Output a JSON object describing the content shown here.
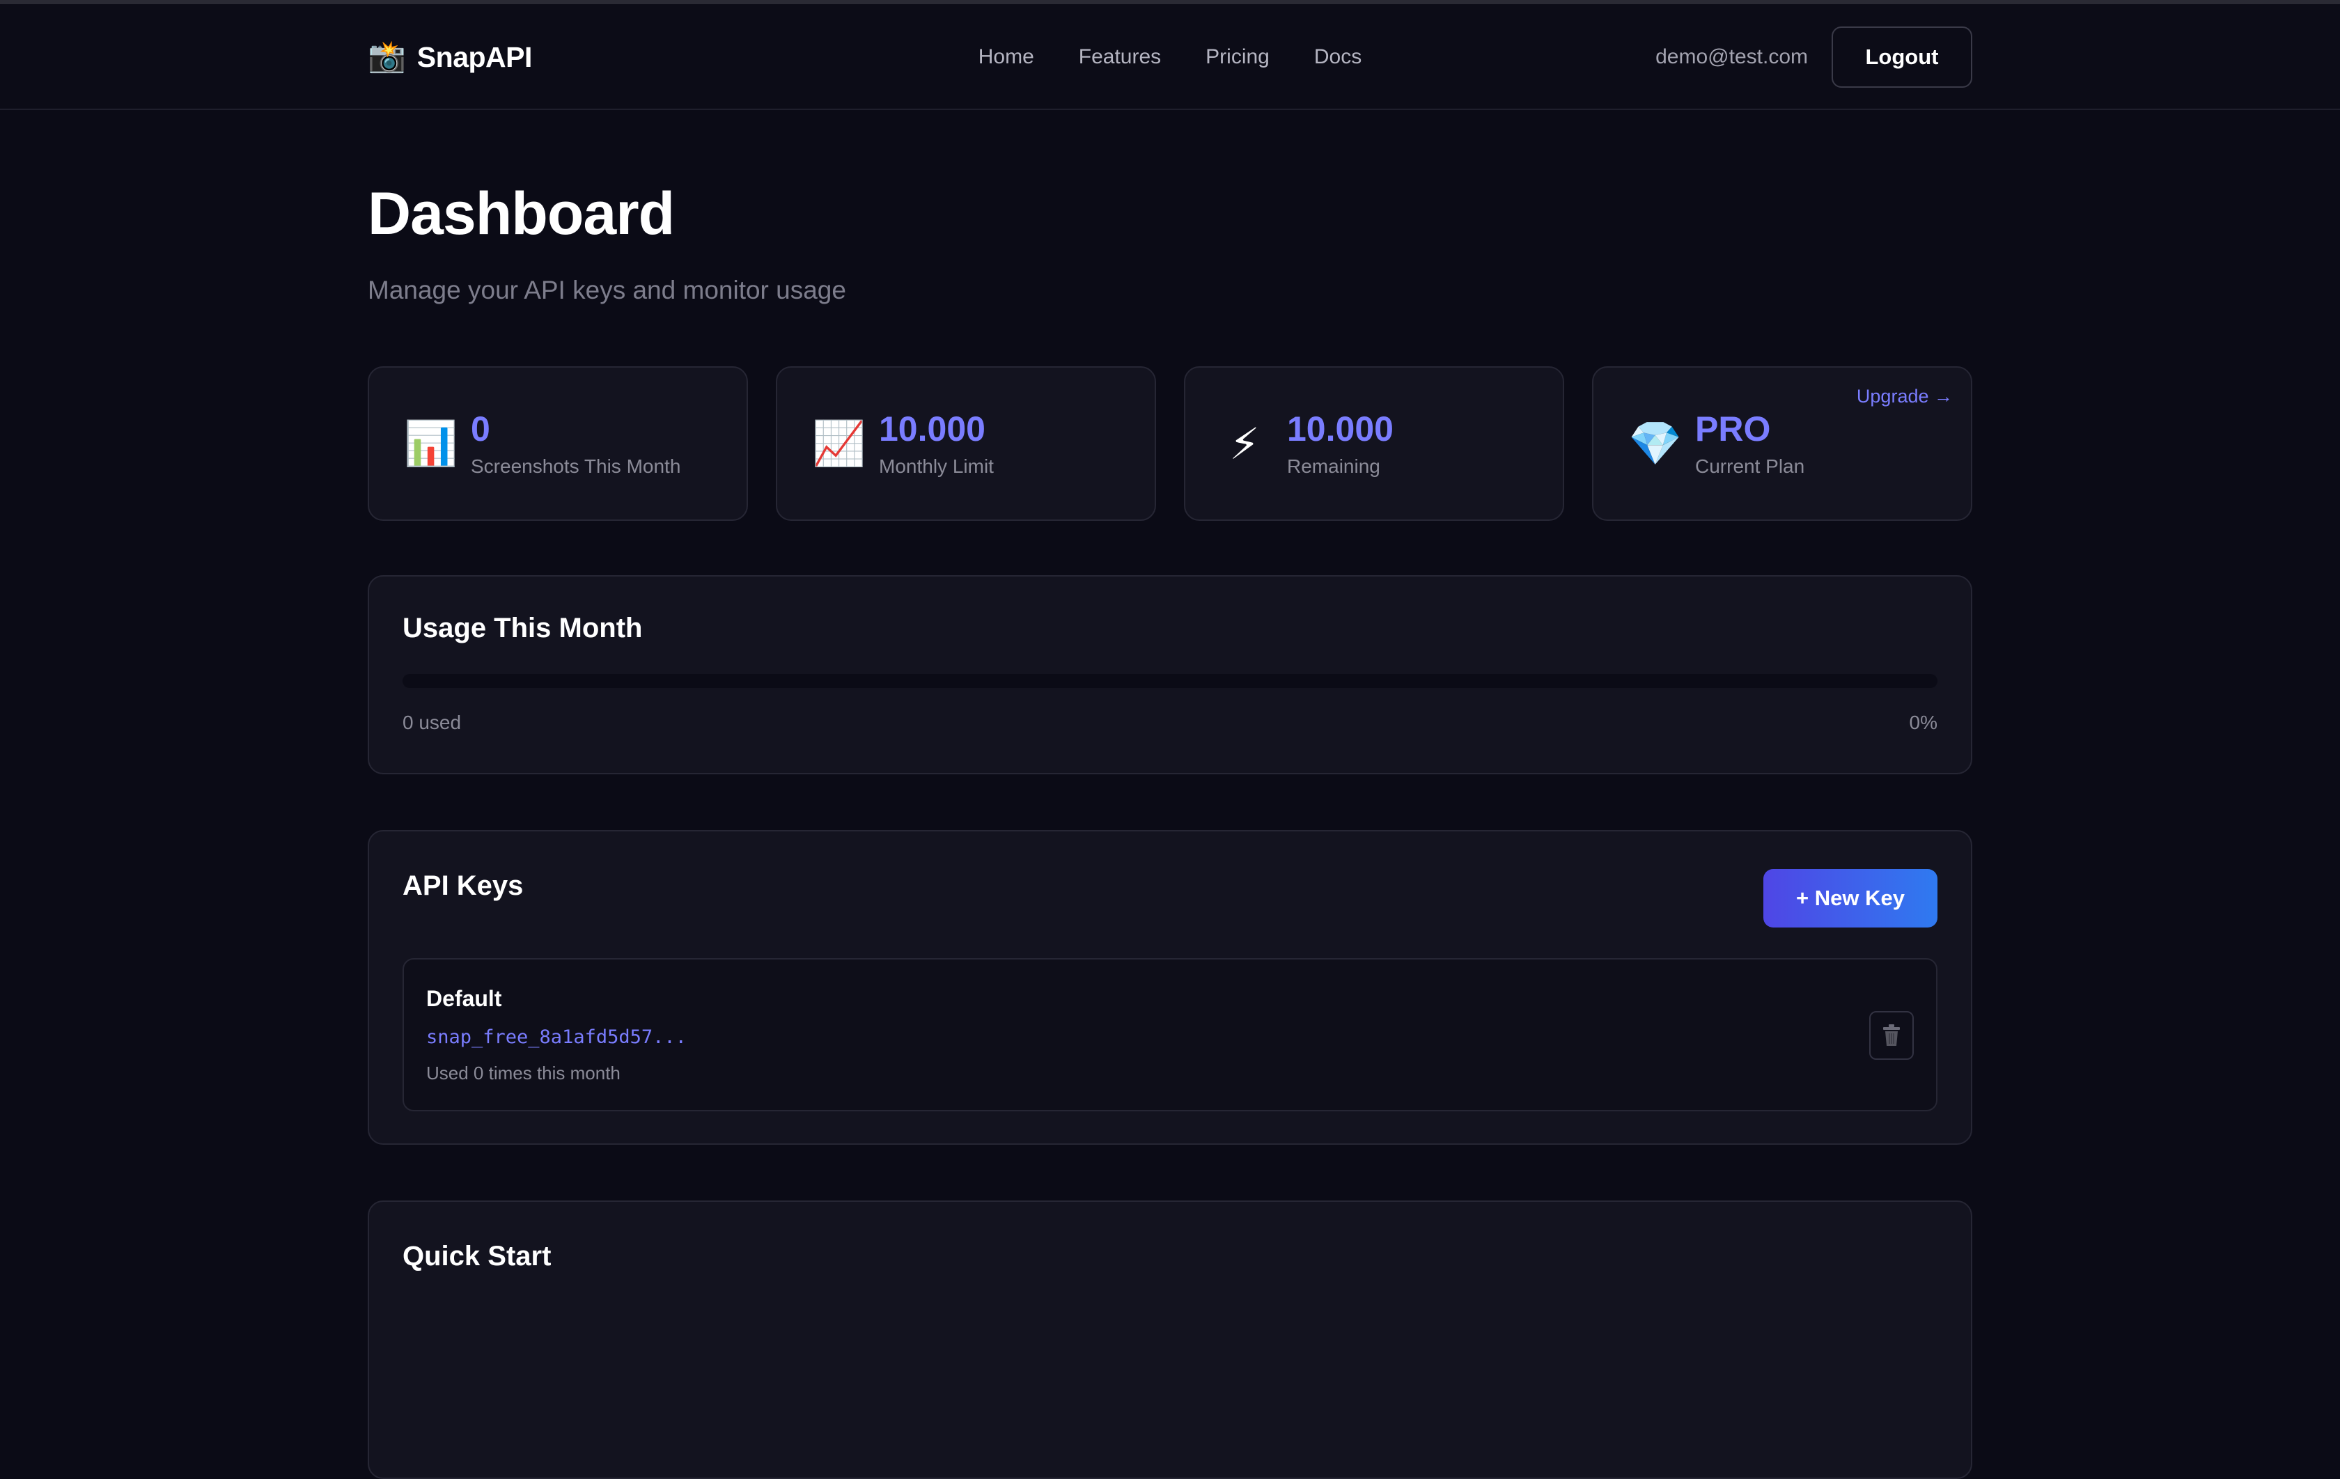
{
  "header": {
    "brand_icon": "📸",
    "brand_name": "SnapAPI",
    "nav": [
      "Home",
      "Features",
      "Pricing",
      "Docs"
    ],
    "user_email": "demo@test.com",
    "logout_label": "Logout"
  },
  "page": {
    "title": "Dashboard",
    "subtitle": "Manage your API keys and monitor usage"
  },
  "stats": [
    {
      "icon": "📊",
      "icon_name": "bar-chart-icon",
      "value": "0",
      "label": "Screenshots This Month"
    },
    {
      "icon": "📈",
      "icon_name": "trending-up-icon",
      "value": "10.000",
      "label": "Monthly Limit"
    },
    {
      "icon": "⚡",
      "icon_name": "lightning-icon",
      "value": "10.000",
      "label": "Remaining"
    },
    {
      "icon": "💎",
      "icon_name": "diamond-icon",
      "value": "PRO",
      "label": "Current Plan",
      "link": "Upgrade →"
    }
  ],
  "usage": {
    "title": "Usage This Month",
    "used_text": "0 used",
    "percent_text": "0%",
    "percent": 0
  },
  "api_keys": {
    "title": "API Keys",
    "new_key_label": "+ New Key",
    "items": [
      {
        "name": "Default",
        "key": "snap_free_8a1afd5d57...",
        "usage": "Used 0 times this month"
      }
    ]
  },
  "quick_start": {
    "title": "Quick Start"
  },
  "colors": {
    "accent": "#7a7dff",
    "background": "#0b0b16",
    "card": "#13131f",
    "button_gradient_start": "#4f46e5",
    "button_gradient_end": "#2f7af0"
  }
}
